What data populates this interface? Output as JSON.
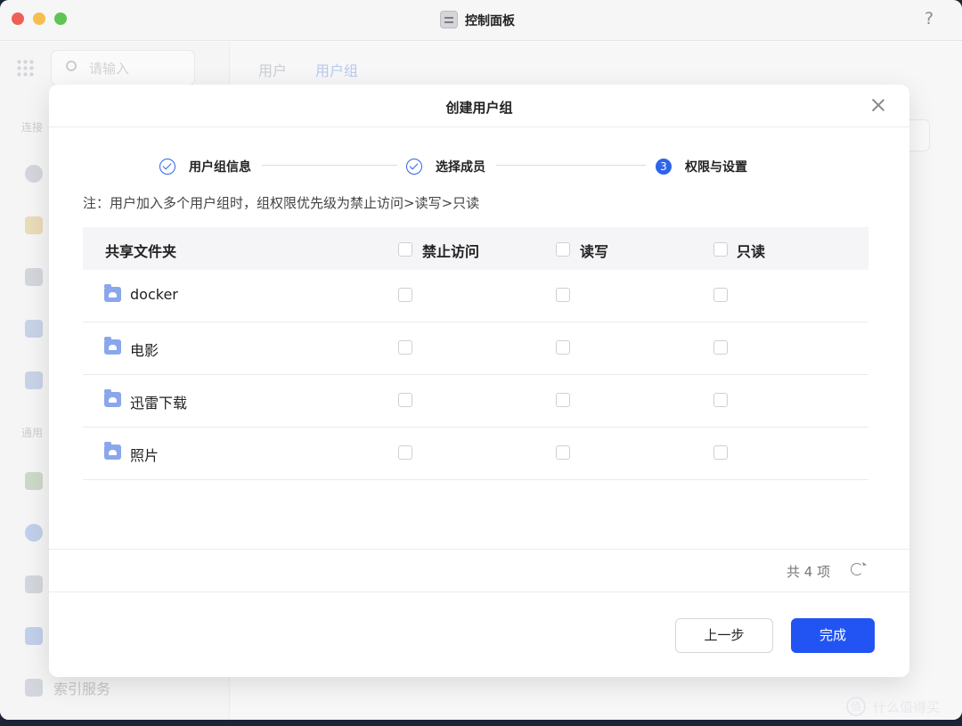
{
  "window": {
    "title": "控制面板",
    "help": "?"
  },
  "background": {
    "search_placeholder": "请输入",
    "sections": [
      "连接",
      "通用"
    ],
    "nav_last_label": "索引服务",
    "tabs": [
      {
        "label": "用户",
        "active": false
      },
      {
        "label": "用户组",
        "active": true
      }
    ]
  },
  "dialog": {
    "title": "创建用户组",
    "steps": [
      {
        "label": "用户组信息",
        "state": "done"
      },
      {
        "label": "选择成员",
        "state": "done"
      },
      {
        "label": "权限与设置",
        "state": "current",
        "number": "3"
      }
    ],
    "note": "注：用户加入多个用户组时，组权限优先级为禁止访问>读写>只读",
    "table": {
      "columns": [
        "共享文件夹",
        "禁止访问",
        "读写",
        "只读"
      ],
      "rows": [
        {
          "name": "docker",
          "deny": false,
          "read_write": false,
          "read_only": false
        },
        {
          "name": "电影",
          "deny": false,
          "read_write": false,
          "read_only": false
        },
        {
          "name": "迅雷下载",
          "deny": false,
          "read_write": false,
          "read_only": false
        },
        {
          "name": "照片",
          "deny": false,
          "read_write": false,
          "read_only": false
        }
      ]
    },
    "total": "共 4 项",
    "buttons": {
      "prev": "上一步",
      "done": "完成"
    }
  },
  "watermark": "什么值得买",
  "colors": {
    "accent": "#2254f4",
    "step": "#2f63ea",
    "folder": "#8aa7ec"
  },
  "icons": [
    "search-icon",
    "grid-icon",
    "close-icon",
    "check-circle-icon",
    "folder-icon",
    "refresh-icon",
    "help-icon"
  ]
}
